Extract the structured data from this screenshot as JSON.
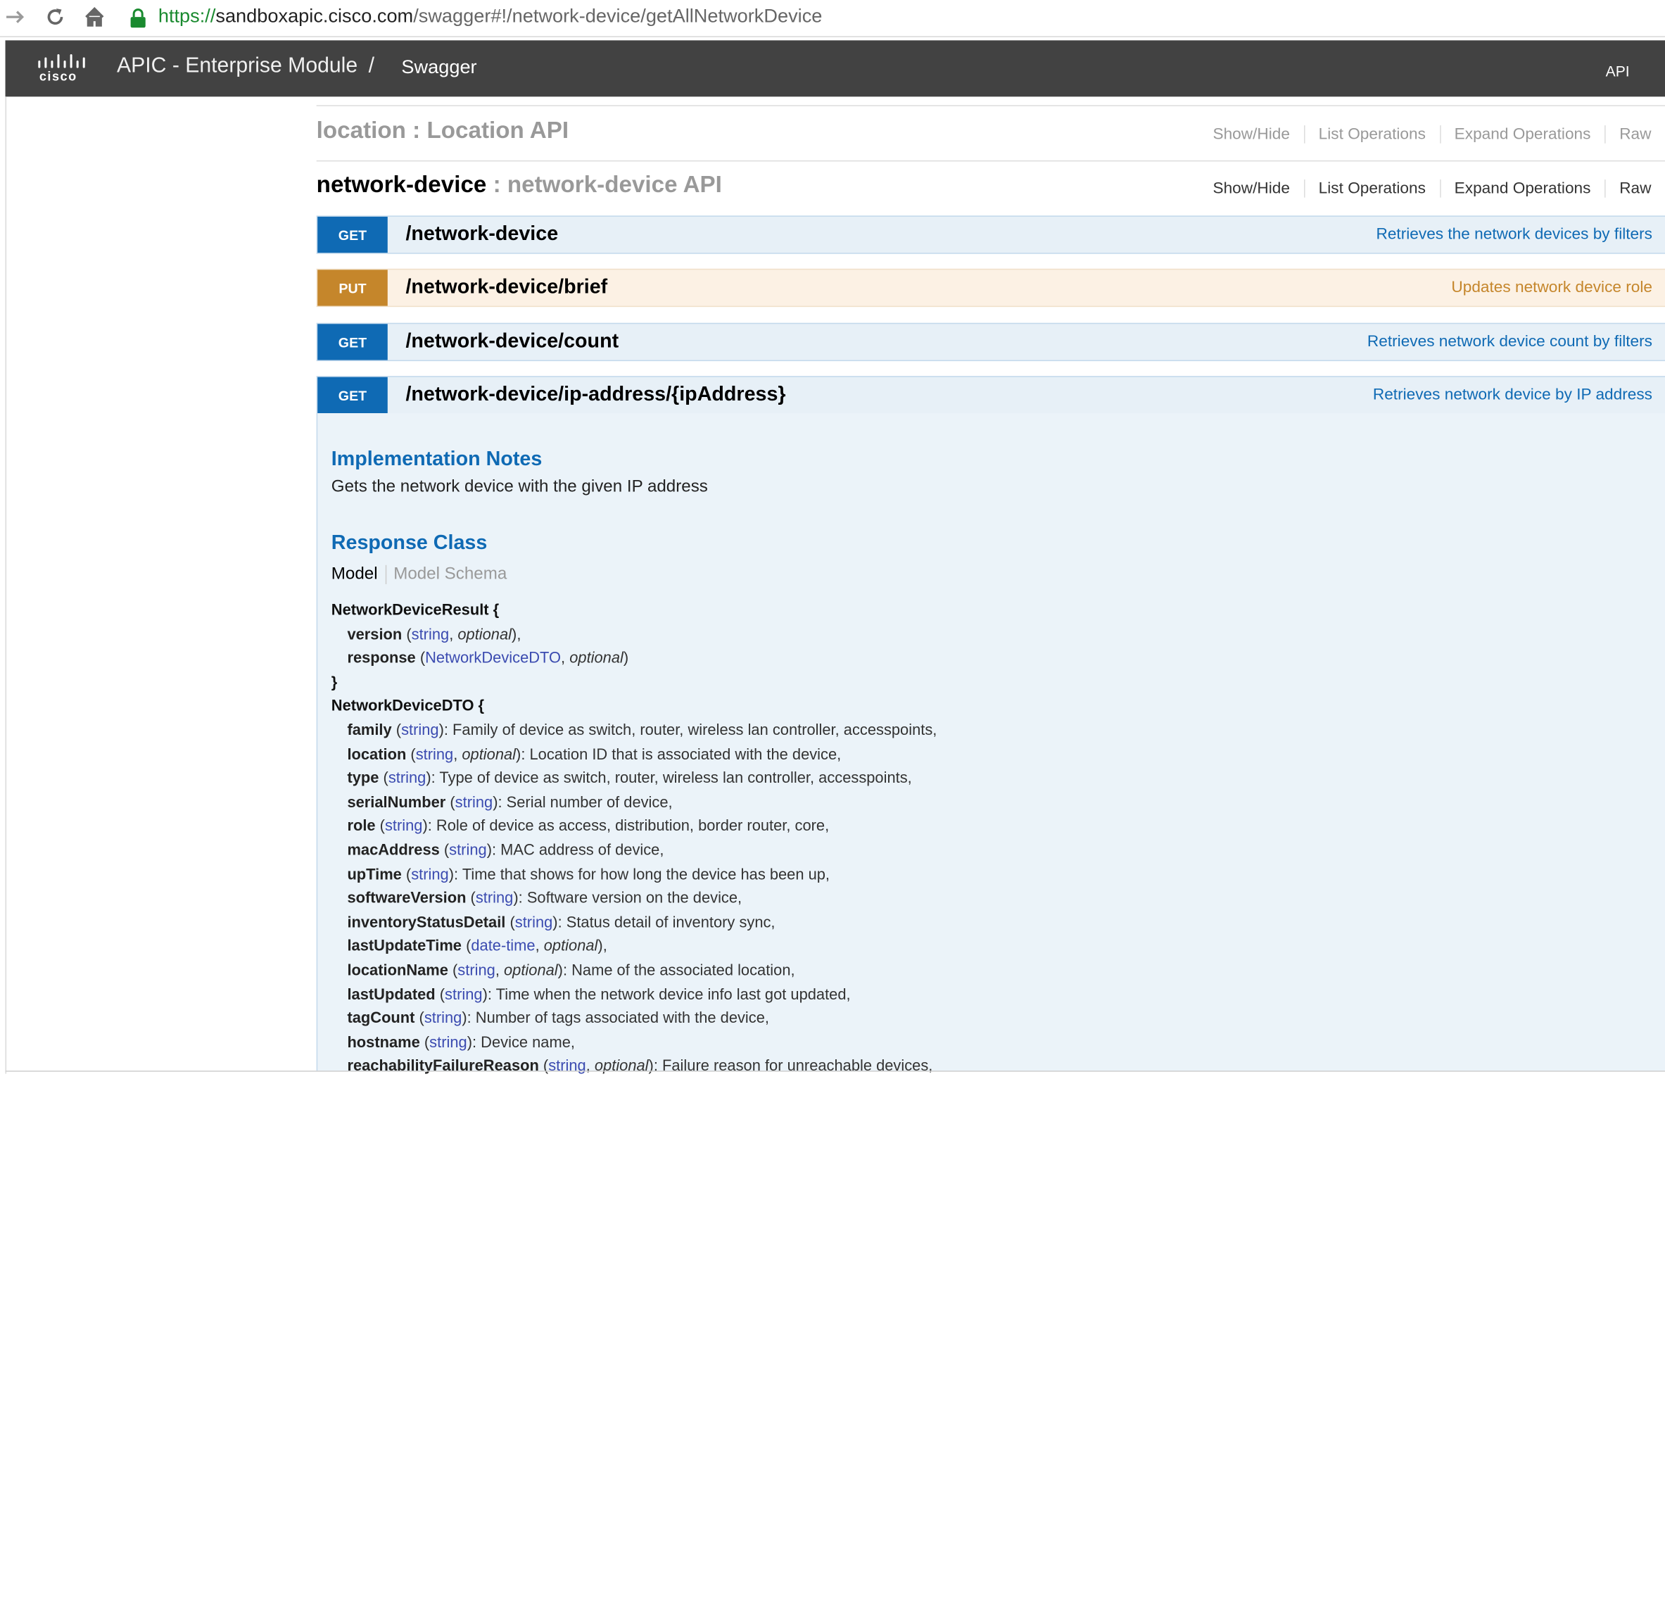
{
  "browser": {
    "url_scheme": "https://",
    "url_host": "sandboxapic.cisco.com",
    "url_path": "/swagger#!/network-device/getAllNetworkDevice",
    "icons": [
      "forward-arrow-icon",
      "reload-icon",
      "home-icon",
      "lock-icon"
    ]
  },
  "header": {
    "logo_text": "cisco",
    "title": "APIC - Enterprise Module",
    "separator": "/",
    "current": "Swagger",
    "api_link": "API"
  },
  "sections": [
    {
      "name": "location",
      "desc": " : Location API",
      "links": [
        "Show/Hide",
        "List Operations",
        "Expand Operations",
        "Raw"
      ]
    },
    {
      "name": "network-device",
      "desc": " : network-device API",
      "links": [
        "Show/Hide",
        "List Operations",
        "Expand Operations",
        "Raw"
      ],
      "operations": [
        {
          "method": "GET",
          "path": "/network-device",
          "summary": "Retrieves the network devices by filters"
        },
        {
          "method": "PUT",
          "path": "/network-device/brief",
          "summary": "Updates network device role"
        },
        {
          "method": "GET",
          "path": "/network-device/count",
          "summary": "Retrieves network device count by filters"
        },
        {
          "method": "GET",
          "path": "/network-device/ip-address/{ipAddress}",
          "summary": "Retrieves network device by IP address"
        }
      ]
    }
  ],
  "expanded": {
    "impl_heading": "Implementation Notes",
    "impl_text": "Gets the network device with the given IP address",
    "response_heading": "Response Class",
    "tab_model": "Model",
    "tab_schema": "Model Schema",
    "model_lines": [
      {
        "name": "NetworkDeviceResult {",
        "type": "",
        "optional": "",
        "desc": "",
        "header": true
      },
      {
        "name": "version",
        "type": "string",
        "optional": "optional",
        "desc": ","
      },
      {
        "name": "response",
        "type": "NetworkDeviceDTO",
        "optional": "optional",
        "desc": ""
      },
      {
        "name": "}",
        "type": "",
        "optional": "",
        "desc": "",
        "header": true
      },
      {
        "name": "NetworkDeviceDTO {",
        "type": "",
        "optional": "",
        "desc": "",
        "header": true
      },
      {
        "name": "family",
        "type": "string",
        "optional": "",
        "desc": ": Family of device as switch, router, wireless lan controller, accesspoints,"
      },
      {
        "name": "location",
        "type": "string",
        "optional": "optional",
        "desc": ": Location ID that is associated with the device,"
      },
      {
        "name": "type",
        "type": "string",
        "optional": "",
        "desc": ": Type of device as switch, router, wireless lan controller, accesspoints,"
      },
      {
        "name": "serialNumber",
        "type": "string",
        "optional": "",
        "desc": ": Serial number of device,"
      },
      {
        "name": "role",
        "type": "string",
        "optional": "",
        "desc": ": Role of device as access, distribution, border router, core,"
      },
      {
        "name": "macAddress",
        "type": "string",
        "optional": "",
        "desc": ": MAC address of device,"
      },
      {
        "name": "upTime",
        "type": "string",
        "optional": "",
        "desc": ": Time that shows for how long the device has been up,"
      },
      {
        "name": "softwareVersion",
        "type": "string",
        "optional": "",
        "desc": ": Software version on the device,"
      },
      {
        "name": "inventoryStatusDetail",
        "type": "string",
        "optional": "",
        "desc": ": Status detail of inventory sync,"
      },
      {
        "name": "lastUpdateTime",
        "type": "date-time",
        "optional": "optional",
        "desc": ","
      },
      {
        "name": "locationName",
        "type": "string",
        "optional": "optional",
        "desc": ": Name of the associated location,"
      },
      {
        "name": "lastUpdated",
        "type": "string",
        "optional": "",
        "desc": ": Time when the network device info last got updated,"
      },
      {
        "name": "tagCount",
        "type": "string",
        "optional": "",
        "desc": ": Number of tags associated with the device,"
      },
      {
        "name": "hostname",
        "type": "string",
        "optional": "",
        "desc": ": Device name,"
      },
      {
        "name": "reachabilityFailureReason",
        "type": "string",
        "optional": "optional",
        "desc": ": Failure reason for unreachable devices,"
      }
    ]
  }
}
